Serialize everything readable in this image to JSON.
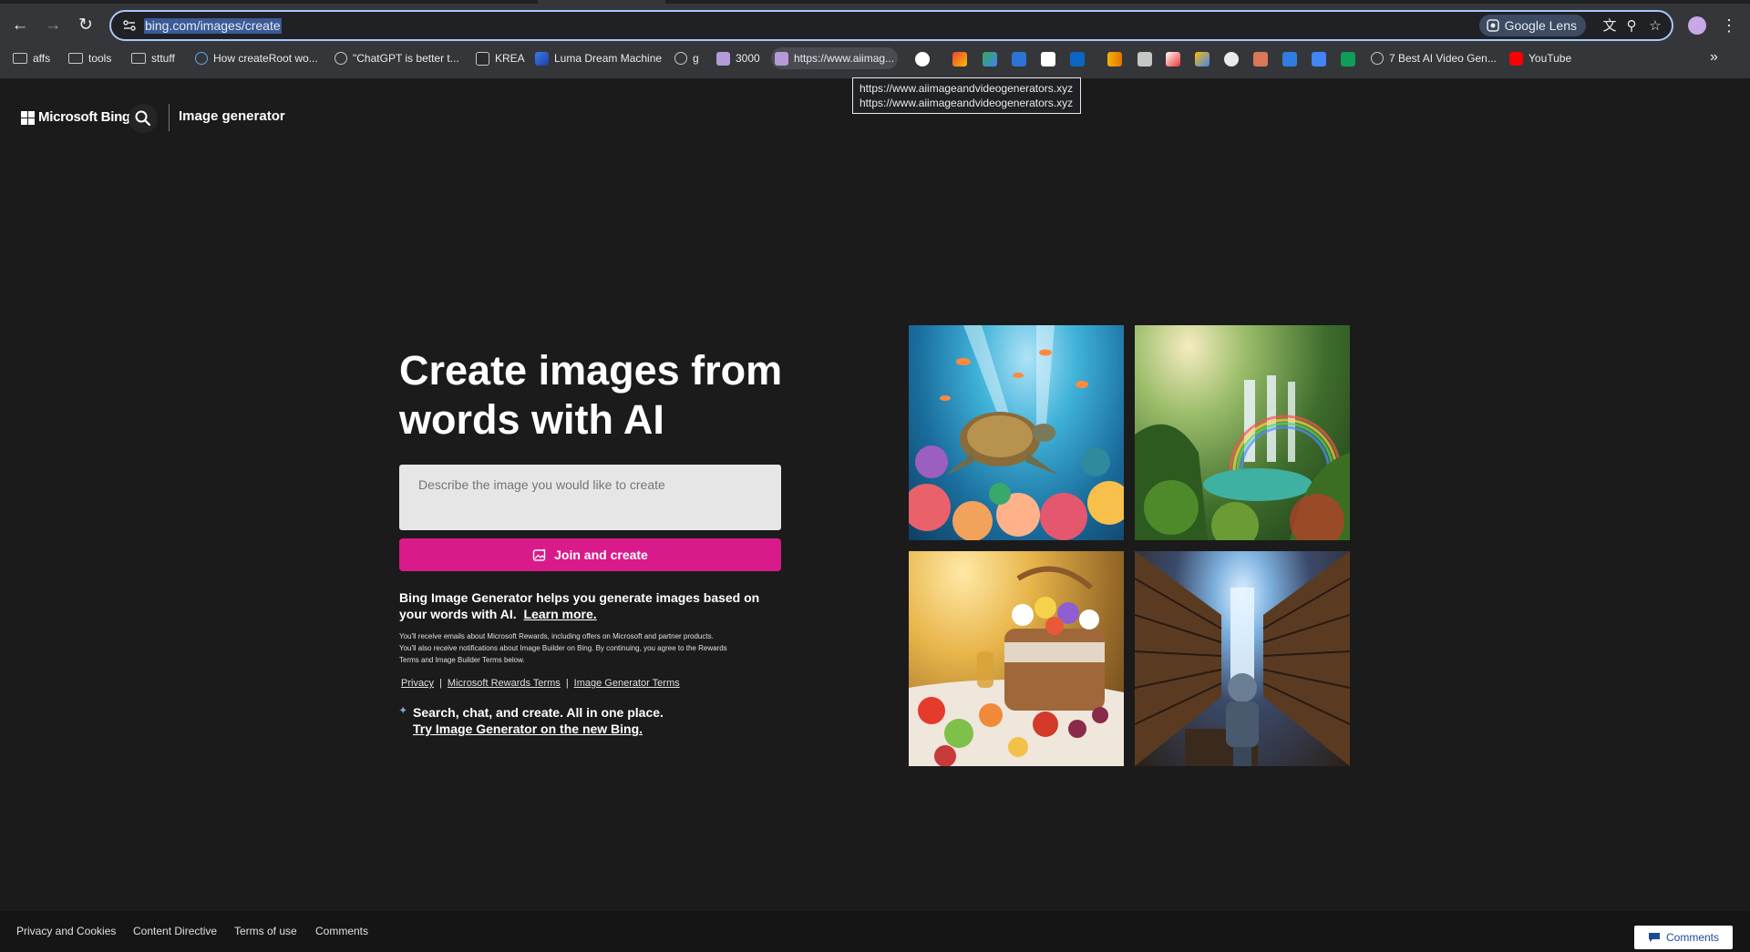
{
  "browser": {
    "url": "bing.com/images/create",
    "lens_label": "Google Lens",
    "bookmarks": [
      {
        "label": "affs",
        "icon": "folder-icon"
      },
      {
        "label": "tools",
        "icon": "folder-icon"
      },
      {
        "label": "sttuff",
        "icon": "folder-icon"
      },
      {
        "label": "How createRoot wo...",
        "icon": "react-icon"
      },
      {
        "label": "\"ChatGPT is better t...",
        "icon": "globe-icon"
      },
      {
        "label": "KREA",
        "icon": "krea-icon"
      },
      {
        "label": "Luma Dream Machine",
        "icon": "luma-icon"
      },
      {
        "label": "g",
        "icon": "globe-icon"
      },
      {
        "label": "3000",
        "icon": "page-icon"
      },
      {
        "label": "https://www.aiimag...",
        "icon": "page-icon"
      },
      {
        "label": "7 Best AI Video Gen...",
        "icon": "globe-icon"
      },
      {
        "label": "YouTube",
        "icon": "youtube-icon"
      }
    ],
    "tooltip_lines": [
      "https://www.aiimageandvideogenerators.xyz",
      "https://www.aiimageandvideogenerators.xyz"
    ]
  },
  "header": {
    "brand": "Microsoft Bing",
    "section_title": "Image generator"
  },
  "hero": {
    "title": "Create images from words with AI",
    "prompt_placeholder": "Describe the image you would like to create",
    "join_button": "Join and create",
    "description": "Bing Image Generator helps you generate images based on your words with AI.",
    "learn_more": "Learn more.",
    "fineprint": "You'll receive emails about Microsoft Rewards, including offers on Microsoft and partner products. You'll also receive notifications about Image Builder on Bing. By continuing, you agree to the Rewards Terms and Image Builder Terms below.",
    "legal_links": [
      "Privacy",
      "Microsoft Rewards Terms",
      "Image Generator Terms"
    ],
    "legal_sep": "|",
    "try_line1": "Search, chat, and create. All in one place.",
    "try_line2": "Try Image Generator on the new Bing."
  },
  "footer": {
    "links": [
      "Privacy and Cookies",
      "Content Directive",
      "Terms of use",
      "Comments"
    ],
    "comments_button": "Comments"
  },
  "colors": {
    "join_button": "#d91a8a",
    "page_bg": "#1b1b1b",
    "omnibox_border": "#a8c7fa"
  }
}
